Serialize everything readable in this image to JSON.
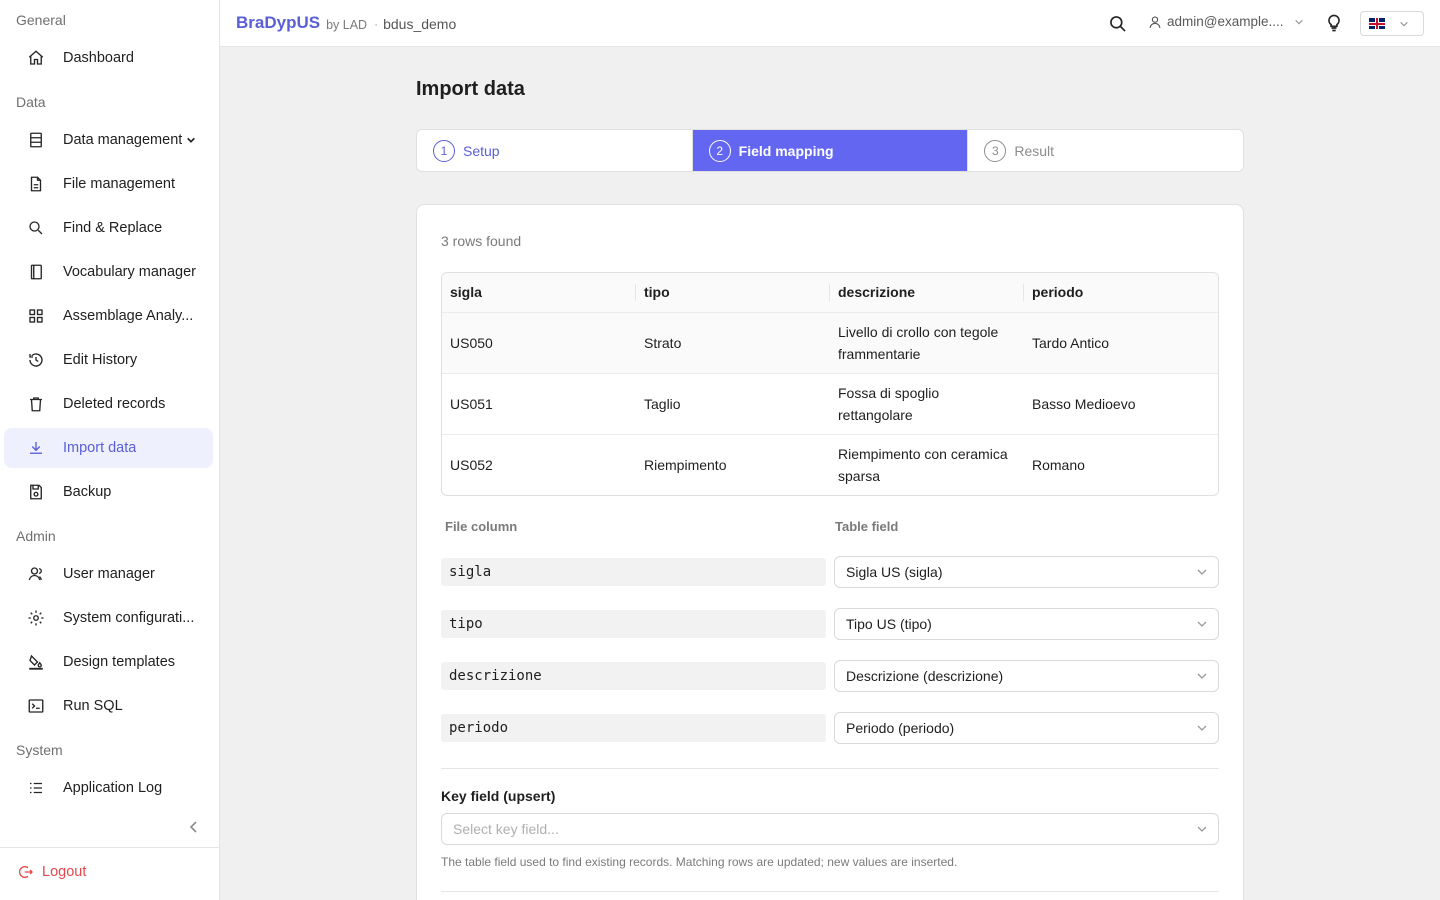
{
  "sidebar": {
    "groups": [
      {
        "title": "General",
        "items": [
          {
            "label": "Dashboard",
            "icon": "home-icon"
          }
        ]
      },
      {
        "title": "Data",
        "items": [
          {
            "label": "Data management",
            "icon": "database-icon"
          },
          {
            "label": "File management",
            "icon": "file-icon"
          },
          {
            "label": "Find & Replace",
            "icon": "search-icon"
          },
          {
            "label": "Vocabulary manager",
            "icon": "book-icon"
          },
          {
            "label": "Assemblage Analy...",
            "icon": "grid-icon"
          },
          {
            "label": "Edit History",
            "icon": "history-icon"
          },
          {
            "label": "Deleted records",
            "icon": "trash-icon"
          },
          {
            "label": "Import data",
            "icon": "download-icon"
          },
          {
            "label": "Backup",
            "icon": "save-icon"
          }
        ]
      },
      {
        "title": "Admin",
        "items": [
          {
            "label": "User manager",
            "icon": "users-icon"
          },
          {
            "label": "System configurati...",
            "icon": "gear-icon"
          },
          {
            "label": "Design templates",
            "icon": "paint-icon"
          },
          {
            "label": "Run SQL",
            "icon": "terminal-icon"
          }
        ]
      },
      {
        "title": "System",
        "items": [
          {
            "label": "Application Log",
            "icon": "list-icon"
          }
        ]
      }
    ],
    "active_item": "Import data",
    "logout_label": "Logout"
  },
  "header": {
    "brand": "BraDypUS",
    "brand_by": "by LAD",
    "separator": "·",
    "database": "bdus_demo",
    "user": "admin@example....",
    "language": "en-GB"
  },
  "page": {
    "title": "Import data",
    "steps": [
      {
        "num": "1",
        "label": "Setup",
        "state": "done"
      },
      {
        "num": "2",
        "label": "Field mapping",
        "state": "active"
      },
      {
        "num": "3",
        "label": "Result",
        "state": "pending"
      }
    ],
    "rows_found": "3 rows found",
    "preview": {
      "columns": [
        "sigla",
        "tipo",
        "descrizione",
        "periodo"
      ],
      "rows": [
        [
          "US050",
          "Strato",
          "Livello di crollo con tegole frammentarie",
          "Tardo Antico"
        ],
        [
          "US051",
          "Taglio",
          "Fossa di spoglio rettangolare",
          "Basso Medioevo"
        ],
        [
          "US052",
          "Riempimento",
          "Riempimento con ceramica sparsa",
          "Romano"
        ]
      ]
    },
    "mapping": {
      "file_column_header": "File column",
      "table_field_header": "Table field",
      "rows": [
        {
          "file_column": "sigla",
          "table_field": "Sigla US (sigla)"
        },
        {
          "file_column": "tipo",
          "table_field": "Tipo US (tipo)"
        },
        {
          "file_column": "descrizione",
          "table_field": "Descrizione (descrizione)"
        },
        {
          "file_column": "periodo",
          "table_field": "Periodo (periodo)"
        }
      ]
    },
    "key_field": {
      "label": "Key field (upsert)",
      "placeholder": "Select key field...",
      "help": "The table field used to find existing records. Matching rows are updated; new values are inserted."
    }
  },
  "colors": {
    "accent": "#6366f1",
    "accent_text": "#5a5fd6",
    "danger": "#e5484d"
  }
}
